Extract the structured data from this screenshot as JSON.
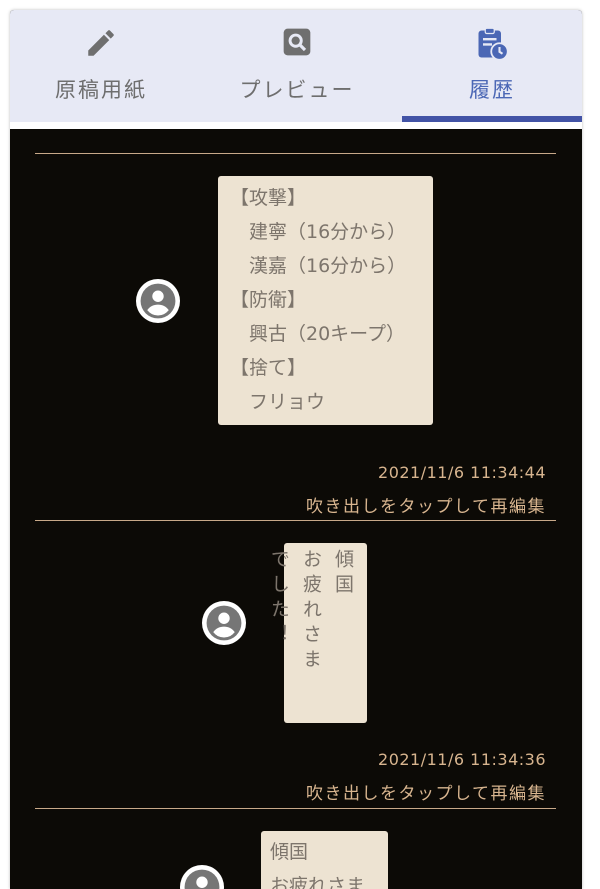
{
  "tabs": [
    {
      "label": "原稿用紙",
      "icon": "pencil-icon"
    },
    {
      "label": "プレビュー",
      "icon": "search-icon"
    },
    {
      "label": "履歴",
      "icon": "clipboard-history-icon",
      "active": true
    }
  ],
  "history": [
    {
      "lines": [
        "【攻撃】",
        "　建寧（16分から）",
        "　漢嘉（16分から）",
        "【防衛】",
        "　興古（20キープ）",
        "【捨て】",
        "　フリョウ"
      ],
      "timestamp": "2021/11/6 11:34:44",
      "edit_hint": "吹き出しをタップして再編集"
    },
    {
      "vertical_text": "お傾\n疲国\nれ\nさ\nま\nでし\nた！",
      "columns": [
        "傾国",
        "お疲れさま",
        "でした！"
      ],
      "timestamp": "2021/11/6 11:34:36",
      "edit_hint": "吹き出しをタップして再編集"
    },
    {
      "lines": [
        "傾国",
        "お疲れさま"
      ]
    }
  ],
  "colors": {
    "tab_bar": "#e7e9f5",
    "active_tab": "#4b67b5",
    "indicator": "#4253a6",
    "background": "#0c0a06",
    "bubble": "#ede3d2",
    "meta_text": "#d8b58f"
  }
}
